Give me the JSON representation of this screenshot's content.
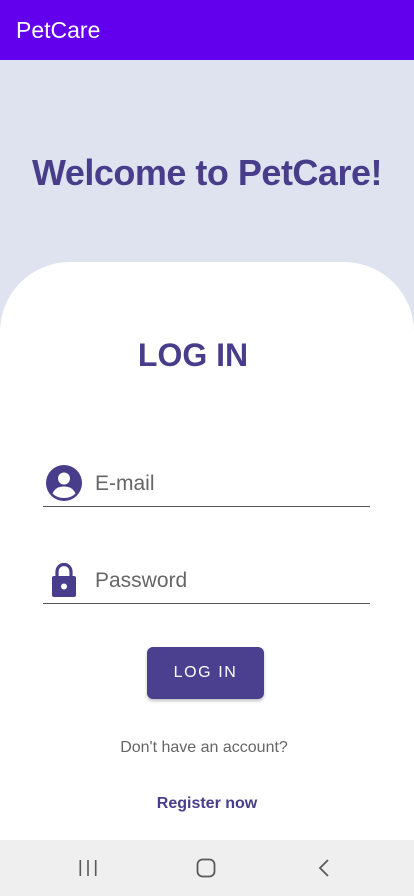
{
  "app_bar": {
    "title": "PetCare",
    "color": "#6200ee"
  },
  "welcome": {
    "text": "Welcome to PetCare!"
  },
  "login": {
    "heading": "LOG IN",
    "email": {
      "placeholder": "E-mail",
      "value": "",
      "icon": "account-circle-icon"
    },
    "password": {
      "placeholder": "Password",
      "value": "",
      "icon": "lock-icon"
    },
    "button_label": "LOG IN",
    "no_account_text": "Don't have an account?",
    "register_label": "Register now"
  },
  "nav_bar": {
    "icons": [
      "recent-apps-icon",
      "home-icon",
      "back-icon"
    ]
  },
  "colors": {
    "primary": "#483d8b",
    "button": "#4b3f8f",
    "background": "#dfe3ef"
  }
}
